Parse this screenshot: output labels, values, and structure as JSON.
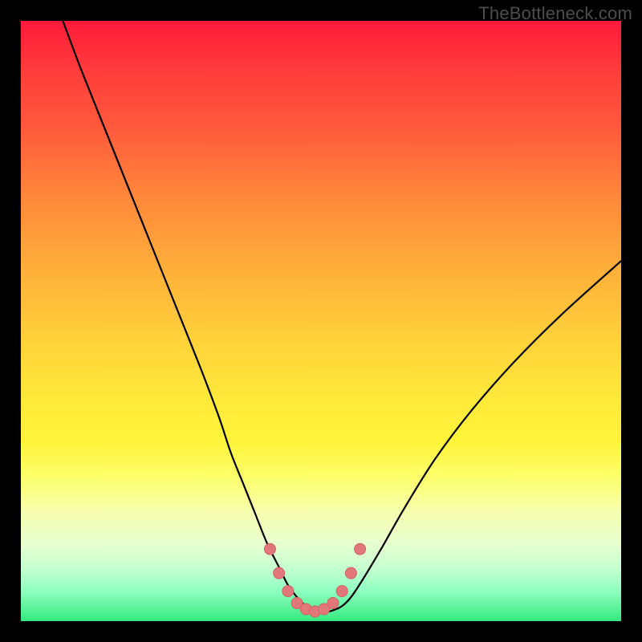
{
  "watermark": {
    "text": "TheBottleneck.com"
  },
  "colors": {
    "frame": "#000000",
    "curve_stroke": "#000000",
    "marker_fill": "#e2777a",
    "marker_stroke": "#d26264"
  },
  "chart_data": {
    "type": "line",
    "title": "",
    "xlabel": "",
    "ylabel": "",
    "xlim": [
      0,
      100
    ],
    "ylim": [
      0,
      100
    ],
    "grid": false,
    "legend": false,
    "series": [
      {
        "name": "bottleneck-curve",
        "x": [
          7,
          10,
          14,
          18,
          22,
          26,
          30,
          33,
          35,
          37,
          39,
          41,
          43,
          44.5,
          46,
          47.5,
          49,
          50.5,
          52,
          53.5,
          55,
          57,
          60,
          64,
          69,
          75,
          82,
          90,
          100
        ],
        "y": [
          100,
          92,
          82,
          72,
          62,
          52,
          42,
          34,
          28,
          23,
          18,
          13,
          9,
          6,
          4,
          2.5,
          1.8,
          1.5,
          1.8,
          2.5,
          4,
          7,
          12,
          19,
          27,
          35,
          43,
          51,
          60
        ]
      }
    ],
    "markers": {
      "name": "valley-markers",
      "x": [
        41.5,
        43,
        44.5,
        46,
        47.5,
        49,
        50.5,
        52,
        53.5,
        55,
        56.5
      ],
      "y": [
        12,
        8,
        5,
        3,
        2,
        1.6,
        2,
        3,
        5,
        8,
        12
      ],
      "radius": 7
    }
  }
}
